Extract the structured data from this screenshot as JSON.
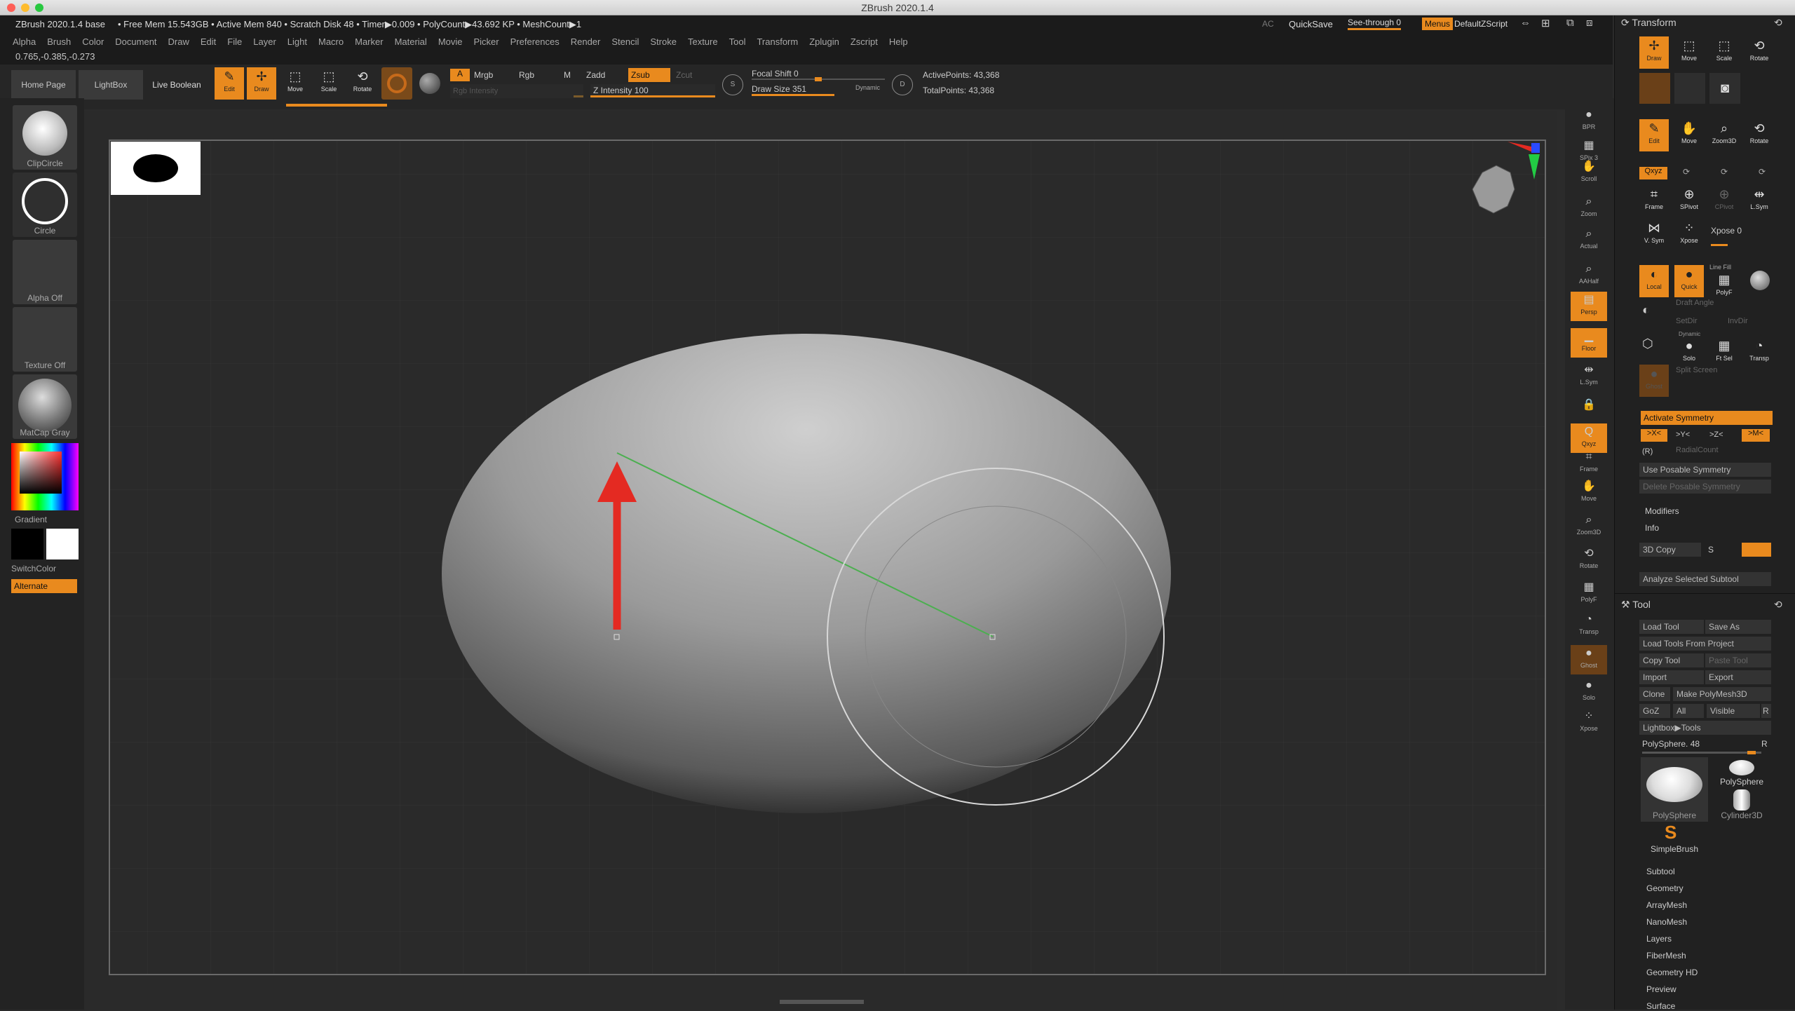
{
  "window": {
    "title": "ZBrush 2020.1.4"
  },
  "infobar": {
    "version": "ZBrush 2020.1.4 base",
    "stats": "• Free Mem 15.543GB • Active Mem 840 • Scratch Disk 48 • Timer▶0.009 • PolyCount▶43.692 KP • MeshCount▶1",
    "ac": "AC",
    "quicksave": "QuickSave",
    "seethrough": "See-through  0",
    "menus": "Menus",
    "defaultzscript": "DefaultZScript"
  },
  "menus": [
    "Alpha",
    "Brush",
    "Color",
    "Document",
    "Draw",
    "Edit",
    "File",
    "Layer",
    "Light",
    "Macro",
    "Marker",
    "Material",
    "Movie",
    "Picker",
    "Preferences",
    "Render",
    "Stencil",
    "Stroke",
    "Texture",
    "Tool",
    "Transform",
    "Zplugin",
    "Zscript",
    "Help"
  ],
  "coords": "0.765,-0.385,-0.273",
  "toolbar": {
    "home": "Home Page",
    "lightbox": "LightBox",
    "liveboolean": "Live Boolean",
    "edit": "Edit",
    "draw": "Draw",
    "move": "Move",
    "scale": "Scale",
    "rotate": "Rotate",
    "a": "A",
    "mrgb": "Mrgb",
    "rgb": "Rgb",
    "m": "M",
    "zadd": "Zadd",
    "zsub": "Zsub",
    "zcut": "Zcut",
    "rgb_intensity": "Rgb Intensity",
    "z_intensity": "Z Intensity 100",
    "focal_shift": "Focal Shift 0",
    "draw_size": "Draw Size 351",
    "dynamic": "Dynamic",
    "active_points": "ActivePoints: 43,368",
    "total_points": "TotalPoints: 43,368"
  },
  "left": {
    "clipcircle": "ClipCircle",
    "circle": "Circle",
    "alpha": "Alpha Off",
    "texture": "Texture Off",
    "matcap": "MatCap Gray",
    "gradient": "Gradient",
    "switchcolor": "SwitchColor",
    "alternate": "Alternate"
  },
  "rightshelf": [
    {
      "icon": "bpr-icon",
      "label": "BPR"
    },
    {
      "icon": "spix-icon",
      "label": "SPix 3"
    },
    {
      "icon": "scroll-icon",
      "label": "Scroll"
    },
    {
      "icon": "zoom-icon",
      "label": "Zoom"
    },
    {
      "icon": "actual-icon",
      "label": "Actual"
    },
    {
      "icon": "aahalf-icon",
      "label": "AAHalf"
    },
    {
      "icon": "persp-icon",
      "label": "Persp"
    },
    {
      "icon": "floor-icon",
      "label": "Floor"
    },
    {
      "icon": "lsym-icon",
      "label": "L.Sym"
    },
    {
      "icon": "lock-icon",
      "label": ""
    },
    {
      "icon": "xyz-icon",
      "label": "Qxyz"
    },
    {
      "icon": "frame-icon",
      "label": "Frame"
    },
    {
      "icon": "move-icon",
      "label": "Move"
    },
    {
      "icon": "zoom3d-icon",
      "label": "Zoom3D"
    },
    {
      "icon": "rotate-icon",
      "label": "Rotate"
    },
    {
      "icon": "linefill-icon",
      "label": "PolyF"
    },
    {
      "icon": "transp-icon",
      "label": "Transp"
    },
    {
      "icon": "ghost-icon",
      "label": "Ghost"
    },
    {
      "icon": "solo-icon",
      "label": "Solo"
    },
    {
      "icon": "xpose-icon",
      "label": "Xpose"
    }
  ],
  "transform": {
    "title": "Transform",
    "draw": "Draw",
    "move": "Move",
    "scale": "Scale",
    "rotate": "Rotate",
    "edit": "Edit",
    "zoom3d": "Zoom3D",
    "xyz": "Qxyz",
    "frame": "Frame",
    "spivot": "SPivot",
    "cpivot": "CPivot",
    "lsym": "L.Sym",
    "vsym": "V. Sym",
    "xpose_btn": "Xpose",
    "xpose": "Xpose 0",
    "local": "Local",
    "quick": "Quick",
    "polyf": "PolyF",
    "line_fill": "Line Fill",
    "draft_angle": "Draft Angle",
    "setdir": "SetDir",
    "invdir": "InvDir",
    "solo": "Solo",
    "ftsel": "Ft Sel",
    "transp": "Transp",
    "dynamic": "Dynamic",
    "ghost": "Ghost",
    "split_screen": "Split Screen",
    "activate_symmetry": "Activate Symmetry",
    "xsym": ">X<",
    "ysym": ">Y<",
    "zsym": ">Z<",
    "msym": ">M<",
    "r": "(R)",
    "radial_count": "RadialCount",
    "use_posable": "Use Posable Symmetry",
    "delete_posable": "Delete Posable Symmetry",
    "modifiers": "Modifiers",
    "info": "Info",
    "copy3d": "3D Copy",
    "s": "S",
    "analyze": "Analyze Selected Subtool"
  },
  "tool": {
    "title": "Tool",
    "load": "Load Tool",
    "saveas": "Save As",
    "loadproject": "Load Tools From Project",
    "copy": "Copy Tool",
    "paste": "Paste Tool",
    "import": "Import",
    "export": "Export",
    "clone": "Clone",
    "makepoly": "Make PolyMesh3D",
    "goz": "GoZ",
    "all": "All",
    "visible": "Visible",
    "r": "R",
    "lightboxtools": "Lightbox▶Tools",
    "polysphere": "PolySphere. 48",
    "thumb1": "PolySphere",
    "thumb2": "PolySphere",
    "thumb3": "Cylinder3D",
    "thumb4": "SimpleBrush",
    "sections": [
      "Subtool",
      "Geometry",
      "ArrayMesh",
      "NanoMesh",
      "Layers",
      "FiberMesh",
      "Geometry HD",
      "Preview",
      "Surface"
    ]
  },
  "colors": {
    "accent": "#e98a1e",
    "bg": "#2b2b2b",
    "panel": "#212121"
  }
}
